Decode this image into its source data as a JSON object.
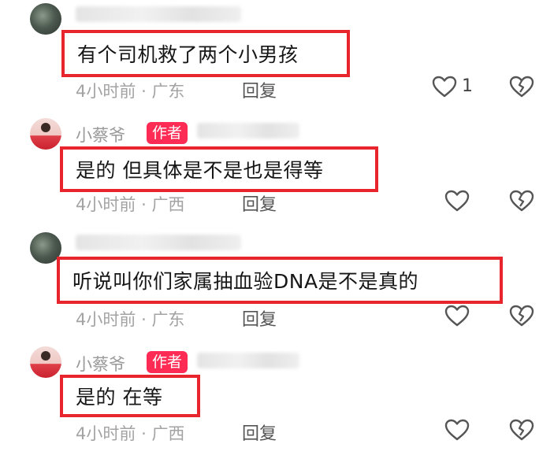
{
  "comments": [
    {
      "username": "",
      "is_author": false,
      "text": "有个司机救了两个小男孩",
      "time": "4小时前",
      "location": "广东",
      "reply_label": "回复",
      "like_count": "1"
    },
    {
      "username": "小蔡爷",
      "is_author": true,
      "author_badge": "作者",
      "text": "是的 但具体是不是也是得等",
      "time": "4小时前",
      "location": "广西",
      "reply_label": "回复",
      "like_count": ""
    },
    {
      "username": "",
      "is_author": false,
      "text": "听说叫你们家属抽血验DNA是不是真的",
      "time": "4小时前",
      "location": "广东",
      "reply_label": "回复",
      "like_count": ""
    },
    {
      "username": "小蔡爷",
      "is_author": true,
      "author_badge": "作者",
      "text": "是的 在等",
      "time": "4小时前",
      "location": "广西",
      "reply_label": "回复",
      "like_count": ""
    }
  ],
  "meta_separator": "·",
  "icons": {
    "like": "heart-outline-icon",
    "dislike": "broken-heart-icon"
  },
  "colors": {
    "highlight_border": "#e8242c",
    "author_badge": "#fe2c55",
    "meta_text": "#a3a3a3"
  }
}
